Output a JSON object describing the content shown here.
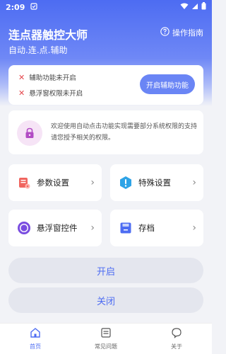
{
  "status_bar": {
    "time": "2:09"
  },
  "header": {
    "title": "连点器触控大师",
    "subtitle": "自动.连.点.辅助",
    "guide_label": "操作指南"
  },
  "permissions": {
    "items": [
      {
        "label": "辅助功能未开启"
      },
      {
        "label": "悬浮窗权限未开启"
      }
    ],
    "enable_button": "开启辅助功能"
  },
  "notice": {
    "text": "欢迎使用自动点击功能实现需要部分系统权限的支持请您授予相关的权限。"
  },
  "grid": [
    {
      "label": "参数设置",
      "icon": "params-icon"
    },
    {
      "label": "特殊设置",
      "icon": "alert-icon"
    },
    {
      "label": "悬浮窗控件",
      "icon": "float-window-icon"
    },
    {
      "label": "存档",
      "icon": "save-icon"
    }
  ],
  "actions": {
    "start": "开启",
    "close": "关闭"
  },
  "bottom_nav": [
    {
      "label": "首页",
      "icon": "home-icon",
      "active": true
    },
    {
      "label": "常见问题",
      "icon": "faq-icon",
      "active": false
    },
    {
      "label": "关于",
      "icon": "about-icon",
      "active": false
    }
  ],
  "colors": {
    "primary": "#4d6cf2",
    "accent_button": "#6a85f5",
    "error": "#e5484d"
  }
}
